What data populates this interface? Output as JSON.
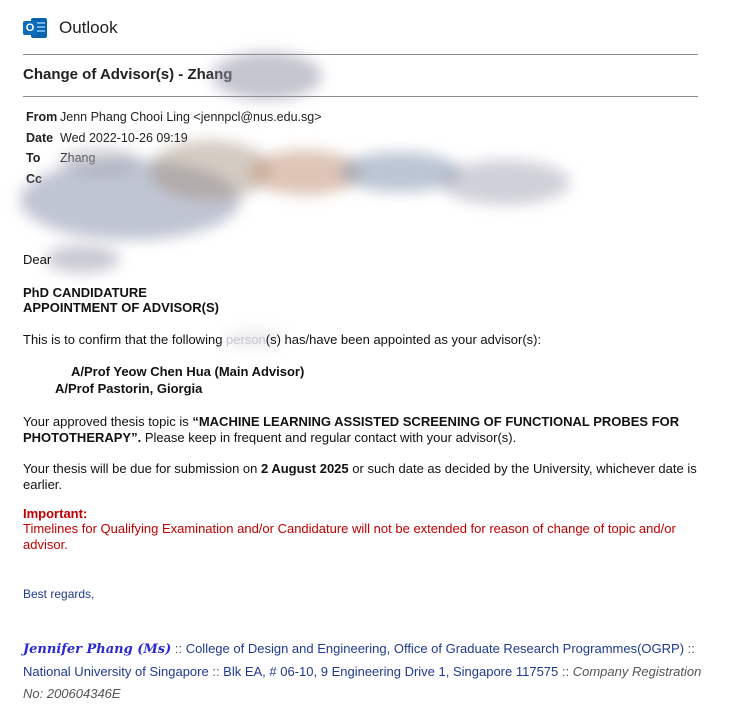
{
  "app": {
    "name": "Outlook",
    "logo_letter": "O"
  },
  "email": {
    "subject": "Change of Advisor(s) - Zhang",
    "from_label": "From",
    "from_value": "Jenn Phang Chooi Ling <jennpcl@nus.edu.sg>",
    "date_label": "Date",
    "date_value": "Wed 2022-10-26 09:19",
    "to_label": "To",
    "to_value": "Zhang",
    "cc_label": "Cc",
    "cc_value": ""
  },
  "body": {
    "greeting": "Dear",
    "heading1": "PhD CANDIDATURE",
    "heading2": "APPOINTMENT OF ADVISOR(S)",
    "confirm_1": "This is to confirm that the following ",
    "confirm_2": "person",
    "confirm_3": "(s) has/have been appointed as your advisor(s):",
    "advisor1": "A/Prof Yeow Chen Hua (Main Advisor)",
    "advisor2": "A/Prof Pastorin, Giorgia",
    "topic_pre": "Your approved thesis topic is ",
    "topic_title": "“MACHINE LEARNING ASSISTED SCREENING OF FUNCTIONAL PROBES FOR PHOTOTHERAPY”.",
    "topic_post": " Please keep in frequent and regular contact with your advisor(s).",
    "due_pre": "Your thesis will be due for submission on ",
    "due_date": "2 August 2025",
    "due_post": " or such date as decided by the University, whichever date is earlier.",
    "important_label": "Important:",
    "important_text": "Timelines for Qualifying Examination and/or Candidature will not be extended for reason of change of topic and/or advisor.",
    "closing": "Best regards,"
  },
  "signature": {
    "name": "Jennifer Phang (Ms)",
    "sep": " :: ",
    "dept": "College of Design and Engineering, Office of Graduate Research Programmes(OGRP)",
    "sep2": " :: ",
    "university": "National University of Singapore",
    "sep3": " :: ",
    "address": "Blk EA, # 06-10, 9 Engineering Drive 1, Singapore 117575",
    "sep4": " :: ",
    "company": "Company Registration No: 200604346E"
  },
  "colors": {
    "outlook_blue": "#0f6cbd",
    "important_red": "#c00000",
    "signature_blue": "#1f3a93"
  }
}
